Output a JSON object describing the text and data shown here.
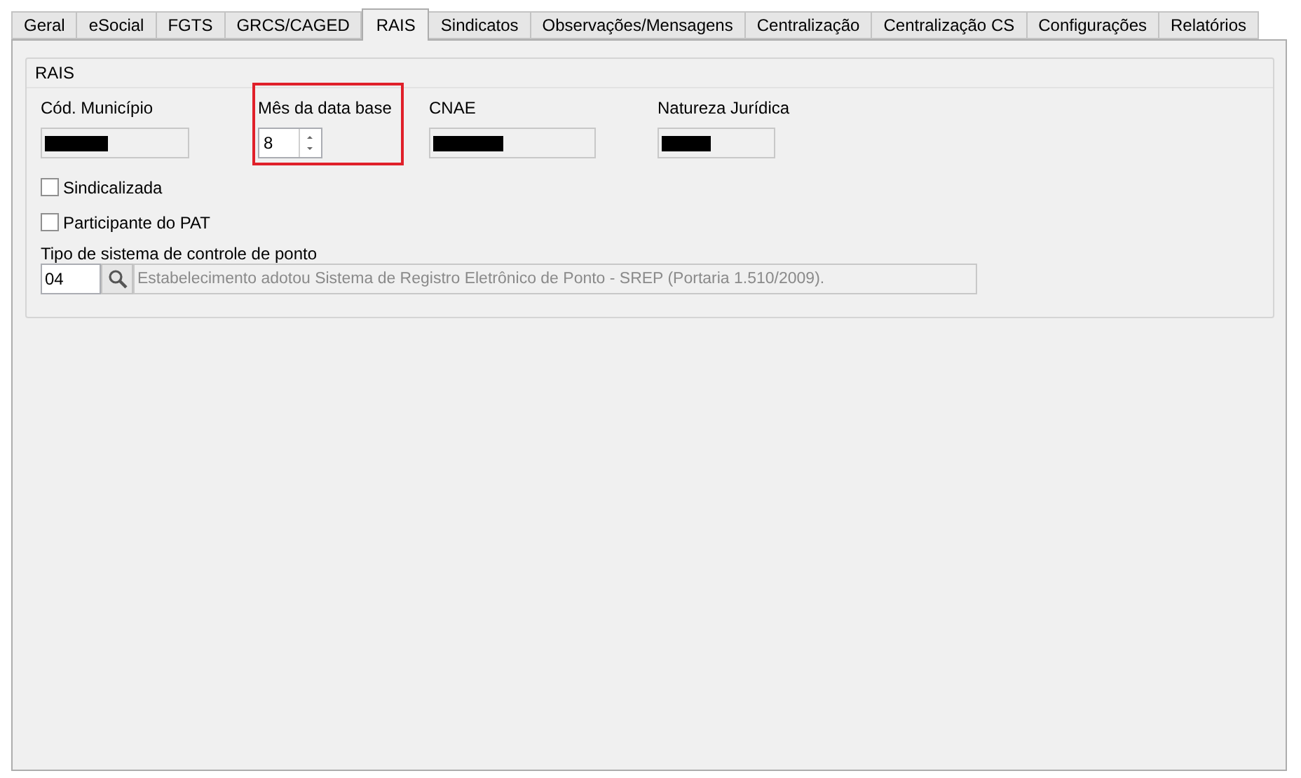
{
  "tabs": [
    {
      "label": "Geral",
      "selected": false
    },
    {
      "label": "eSocial",
      "selected": false
    },
    {
      "label": "FGTS",
      "selected": false
    },
    {
      "label": "GRCS/CAGED",
      "selected": false
    },
    {
      "label": "RAIS",
      "selected": true
    },
    {
      "label": "Sindicatos",
      "selected": false
    },
    {
      "label": "Observações/Mensagens",
      "selected": false
    },
    {
      "label": "Centralização",
      "selected": false
    },
    {
      "label": "Centralização CS",
      "selected": false
    },
    {
      "label": "Configurações",
      "selected": false
    },
    {
      "label": "Relatórios",
      "selected": false
    }
  ],
  "group": {
    "title": "RAIS",
    "fields": [
      {
        "kind": "text",
        "label": "Cód. Município",
        "redacted": true,
        "highlighted": false
      },
      {
        "kind": "spinner",
        "label": "Mês da data base",
        "value": "8",
        "highlighted": true
      },
      {
        "kind": "text",
        "label": "CNAE",
        "redacted": true,
        "highlighted": false
      },
      {
        "kind": "text",
        "label": "Natureza Jurídica",
        "redacted": true,
        "highlighted": false
      }
    ],
    "checkboxes": [
      {
        "label": "Sindicalizada",
        "checked": false
      },
      {
        "label": "Participante do PAT",
        "checked": false
      }
    ],
    "lookup": {
      "label": "Tipo de sistema de controle de ponto",
      "code": "04",
      "description": "Estabelecimento adotou Sistema de Registro Eletrônico de Ponto - SREP (Portaria 1.510/2009)."
    }
  }
}
